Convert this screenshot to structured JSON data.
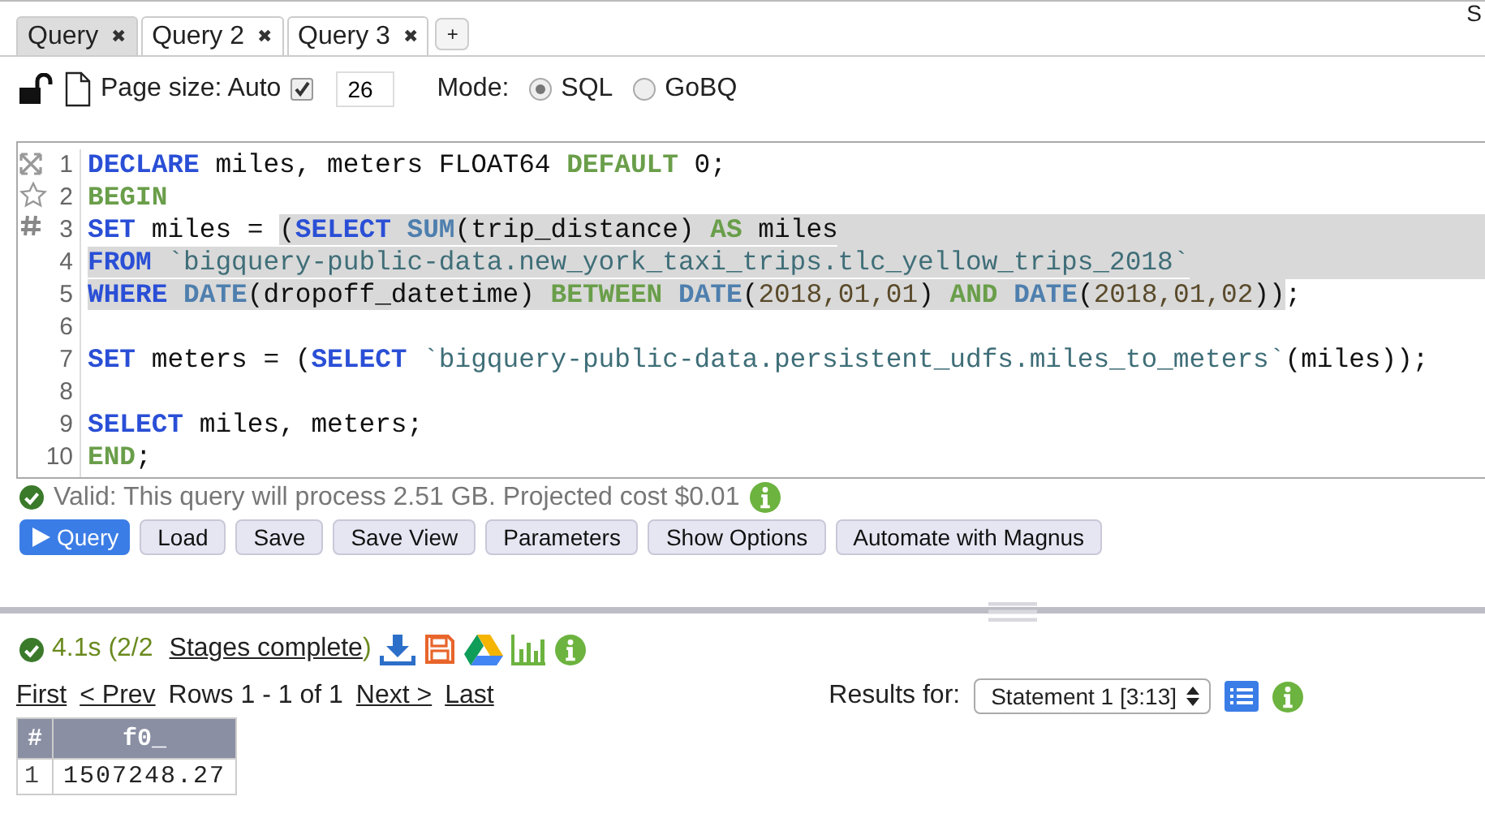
{
  "tabs": [
    {
      "label": "Query",
      "close": "✖",
      "selected": true
    },
    {
      "label": "Query 2",
      "close": "✖",
      "selected": false
    },
    {
      "label": "Query 3",
      "close": "✖",
      "selected": false
    }
  ],
  "add_tab": "+",
  "corner_text": "S",
  "toolbar": {
    "page_size_label": "Page size: Auto",
    "auto_checked": true,
    "page_size_value": "26",
    "mode_label": "Mode:",
    "modes": [
      {
        "label": "SQL",
        "selected": true
      },
      {
        "label": "GoBQ",
        "selected": false
      }
    ]
  },
  "editor": {
    "lines": [
      {
        "number": "1",
        "highlight_to_edge": false,
        "tokens": [
          {
            "text": "DECLARE",
            "kind": "keyword",
            "highlighted": false
          },
          {
            "text": " miles, meters FLOAT64 ",
            "kind": "plain",
            "highlighted": false
          },
          {
            "text": "DEFAULT",
            "kind": "control",
            "highlighted": false
          },
          {
            "text": " 0;",
            "kind": "plain",
            "highlighted": false
          }
        ]
      },
      {
        "number": "2",
        "highlight_to_edge": false,
        "tokens": [
          {
            "text": "BEGIN",
            "kind": "control",
            "highlighted": false
          }
        ]
      },
      {
        "number": "3",
        "highlight_to_edge": true,
        "tokens": [
          {
            "text": "SET",
            "kind": "keyword",
            "highlighted": false
          },
          {
            "text": " miles = ",
            "kind": "plain",
            "highlighted": false
          },
          {
            "text": "(",
            "kind": "plain",
            "highlighted": true
          },
          {
            "text": "SELECT ",
            "kind": "keyword",
            "highlighted": true
          },
          {
            "text": "SUM",
            "kind": "function",
            "highlighted": true
          },
          {
            "text": "(trip_distance) ",
            "kind": "plain",
            "highlighted": true
          },
          {
            "text": "AS",
            "kind": "control",
            "highlighted": true
          },
          {
            "text": " miles",
            "kind": "plain",
            "highlighted": true
          }
        ]
      },
      {
        "number": "4",
        "highlight_to_edge": true,
        "tokens": [
          {
            "text": "FROM ",
            "kind": "keyword",
            "highlighted": true
          },
          {
            "text": "`bigquery-public-data.new_york_taxi_trips.tlc_yellow_trips_2018`",
            "kind": "string",
            "highlighted": true
          }
        ]
      },
      {
        "number": "5",
        "highlight_to_edge": false,
        "tokens": [
          {
            "text": "WHERE ",
            "kind": "keyword",
            "highlighted": true
          },
          {
            "text": "DATE",
            "kind": "function",
            "highlighted": true
          },
          {
            "text": "(dropoff_datetime) ",
            "kind": "plain",
            "highlighted": true
          },
          {
            "text": "BETWEEN ",
            "kind": "control",
            "highlighted": true
          },
          {
            "text": "DATE",
            "kind": "function",
            "highlighted": true
          },
          {
            "text": "(",
            "kind": "plain",
            "highlighted": true
          },
          {
            "text": "2018,01,01",
            "kind": "number",
            "highlighted": true
          },
          {
            "text": ") ",
            "kind": "plain",
            "highlighted": true
          },
          {
            "text": "AND ",
            "kind": "control",
            "highlighted": true
          },
          {
            "text": "DATE",
            "kind": "function",
            "highlighted": true
          },
          {
            "text": "(",
            "kind": "plain",
            "highlighted": true
          },
          {
            "text": "2018,01,02",
            "kind": "number",
            "highlighted": true
          },
          {
            "text": "))",
            "kind": "plain",
            "highlighted": true
          },
          {
            "text": ";",
            "kind": "plain",
            "highlighted": false
          }
        ]
      },
      {
        "number": "6",
        "highlight_to_edge": false
      },
      {
        "number": "7",
        "highlight_to_edge": false,
        "tokens": [
          {
            "text": "SET",
            "kind": "keyword",
            "highlighted": false
          },
          {
            "text": " meters = (",
            "kind": "plain",
            "highlighted": false
          },
          {
            "text": "SELECT ",
            "kind": "keyword",
            "highlighted": false
          },
          {
            "text": "`bigquery-public-data.persistent_udfs.miles_to_meters`",
            "kind": "string",
            "highlighted": false
          },
          {
            "text": "(miles));",
            "kind": "plain",
            "highlighted": false
          }
        ]
      },
      {
        "number": "8",
        "highlight_to_edge": false
      },
      {
        "number": "9",
        "highlight_to_edge": false,
        "tokens": [
          {
            "text": "SELECT",
            "kind": "keyword",
            "highlighted": false
          },
          {
            "text": " miles, meters;",
            "kind": "plain",
            "highlighted": false
          }
        ]
      },
      {
        "number": "10",
        "highlight_to_edge": false,
        "tokens": [
          {
            "text": "END",
            "kind": "control",
            "highlighted": false
          },
          {
            "text": ";",
            "kind": "plain",
            "highlighted": false
          }
        ]
      }
    ]
  },
  "validation": {
    "message": "Valid: This query will process 2.51 GB. Projected cost $0.01"
  },
  "buttons": [
    {
      "label": "Query",
      "kind": "primary"
    },
    {
      "label": "Load",
      "kind": "default"
    },
    {
      "label": "Save",
      "kind": "default"
    },
    {
      "label": "Save View",
      "kind": "default"
    },
    {
      "label": "Parameters",
      "kind": "default"
    },
    {
      "label": "Show Options",
      "kind": "default"
    },
    {
      "label": "Automate with Magnus",
      "kind": "default"
    }
  ],
  "results": {
    "status_prefix": "4.1s (2/2",
    "stages_link": "Stages complete",
    "status_suffix": ")",
    "pager": {
      "first": "First",
      "prev": "< Prev",
      "rows": "Rows 1 - 1 of 1",
      "next": "Next >",
      "last": "Last"
    },
    "results_for_label": "Results for:",
    "statement": "Statement 1 [3:13]",
    "table": {
      "columns": [
        "#",
        "f0_"
      ],
      "rows": [
        [
          "1",
          "1507248.27"
        ]
      ]
    }
  }
}
